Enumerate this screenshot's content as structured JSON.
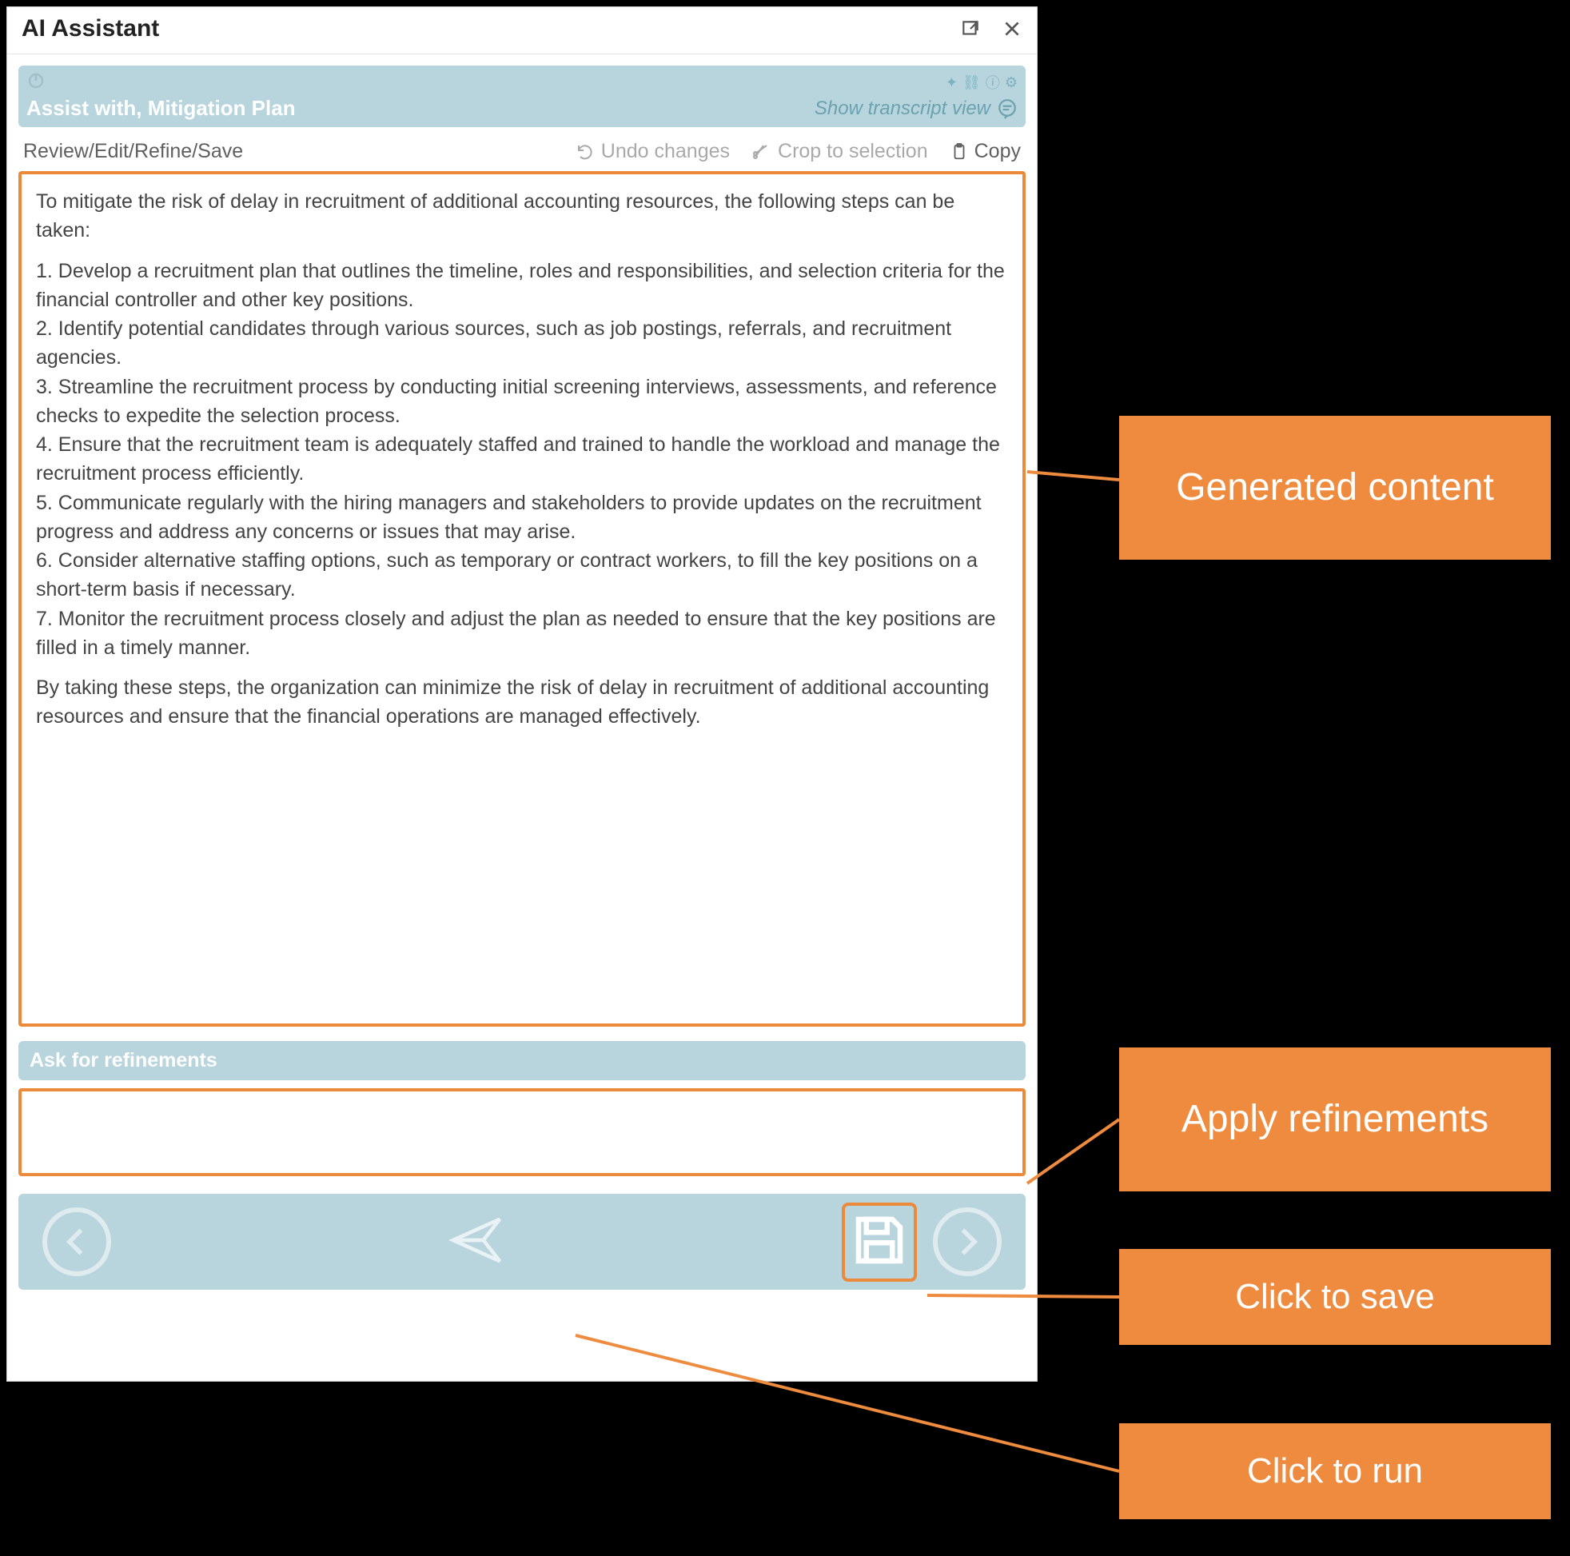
{
  "window": {
    "title": "AI Assistant"
  },
  "band": {
    "title": "Assist with, Mitigation Plan",
    "transcript_link": "Show transcript view"
  },
  "toolbar": {
    "left_label": "Review/Edit/Refine/Save",
    "undo": "Undo changes",
    "crop": "Crop to selection",
    "copy": "Copy"
  },
  "content": {
    "intro": "To mitigate the risk of delay in recruitment of additional accounting resources, the following steps can be taken:",
    "items": [
      "1. Develop a recruitment plan that outlines the timeline, roles and responsibilities, and selection criteria for the financial controller and other key positions.",
      "2. Identify potential candidates through various sources, such as job postings, referrals, and recruitment agencies.",
      "3. Streamline the recruitment process by conducting initial screening interviews, assessments, and reference checks to expedite the selection process.",
      "4. Ensure that the recruitment team is adequately staffed and trained to handle the workload and manage the recruitment process efficiently.",
      "5. Communicate regularly with the hiring managers and stakeholders to provide updates on the recruitment progress and address any concerns or issues that may arise.",
      "6. Consider alternative staffing options, such as temporary or contract workers, to fill the key positions on a short-term basis if necessary.",
      "7. Monitor the recruitment process closely and adjust the plan as needed to ensure that the key positions are filled in a timely manner."
    ],
    "outro": "By taking these steps, the organization can minimize the risk of delay in recruitment of additional accounting resources and ensure that the financial operations are managed effectively."
  },
  "refine": {
    "label": "Ask for refinements"
  },
  "callouts": {
    "generated": "Generated content",
    "apply": "Apply refinements",
    "save": "Click to save",
    "run": "Click to run"
  }
}
